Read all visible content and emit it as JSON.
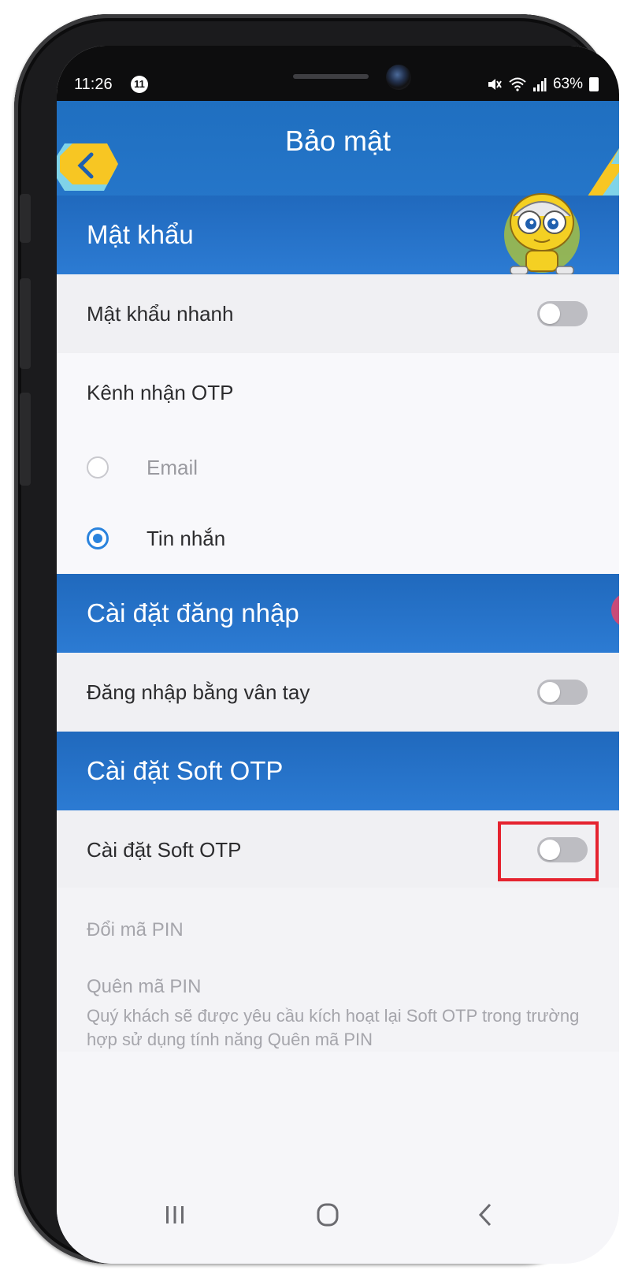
{
  "status_bar": {
    "time": "11:26",
    "notification_badge": "11",
    "signal_text": "N  ≈  .∥",
    "battery": "63%"
  },
  "header": {
    "title": "Bảo mật"
  },
  "sections": {
    "password": {
      "title": "Mật khẩu",
      "quick_password_label": "Mật khẩu nhanh",
      "quick_password_on": false,
      "otp_channel_label": "Kênh nhận OTP",
      "otp_options": [
        {
          "label": "Email",
          "selected": false
        },
        {
          "label": "Tin nhắn",
          "selected": true
        }
      ]
    },
    "login": {
      "title": "Cài đặt đăng nhập",
      "fingerprint_label": "Đăng nhập bằng vân tay",
      "fingerprint_on": false
    },
    "soft_otp": {
      "title": "Cài đặt Soft OTP",
      "soft_otp_label": "Cài đặt Soft OTP",
      "soft_otp_on": false,
      "change_pin": "Đổi mã PIN",
      "forgot_pin": "Quên mã PIN",
      "forgot_pin_note": "Quý khách sẽ được yêu cầu kích hoạt lại Soft OTP trong trường hợp sử dụng tính năng Quên mã PIN"
    }
  },
  "colors": {
    "header_blue": "#2a7bd0",
    "highlight_red": "#e5232f",
    "radio_blue": "#2a83dd",
    "toggle_off": "#bdbdc2"
  }
}
